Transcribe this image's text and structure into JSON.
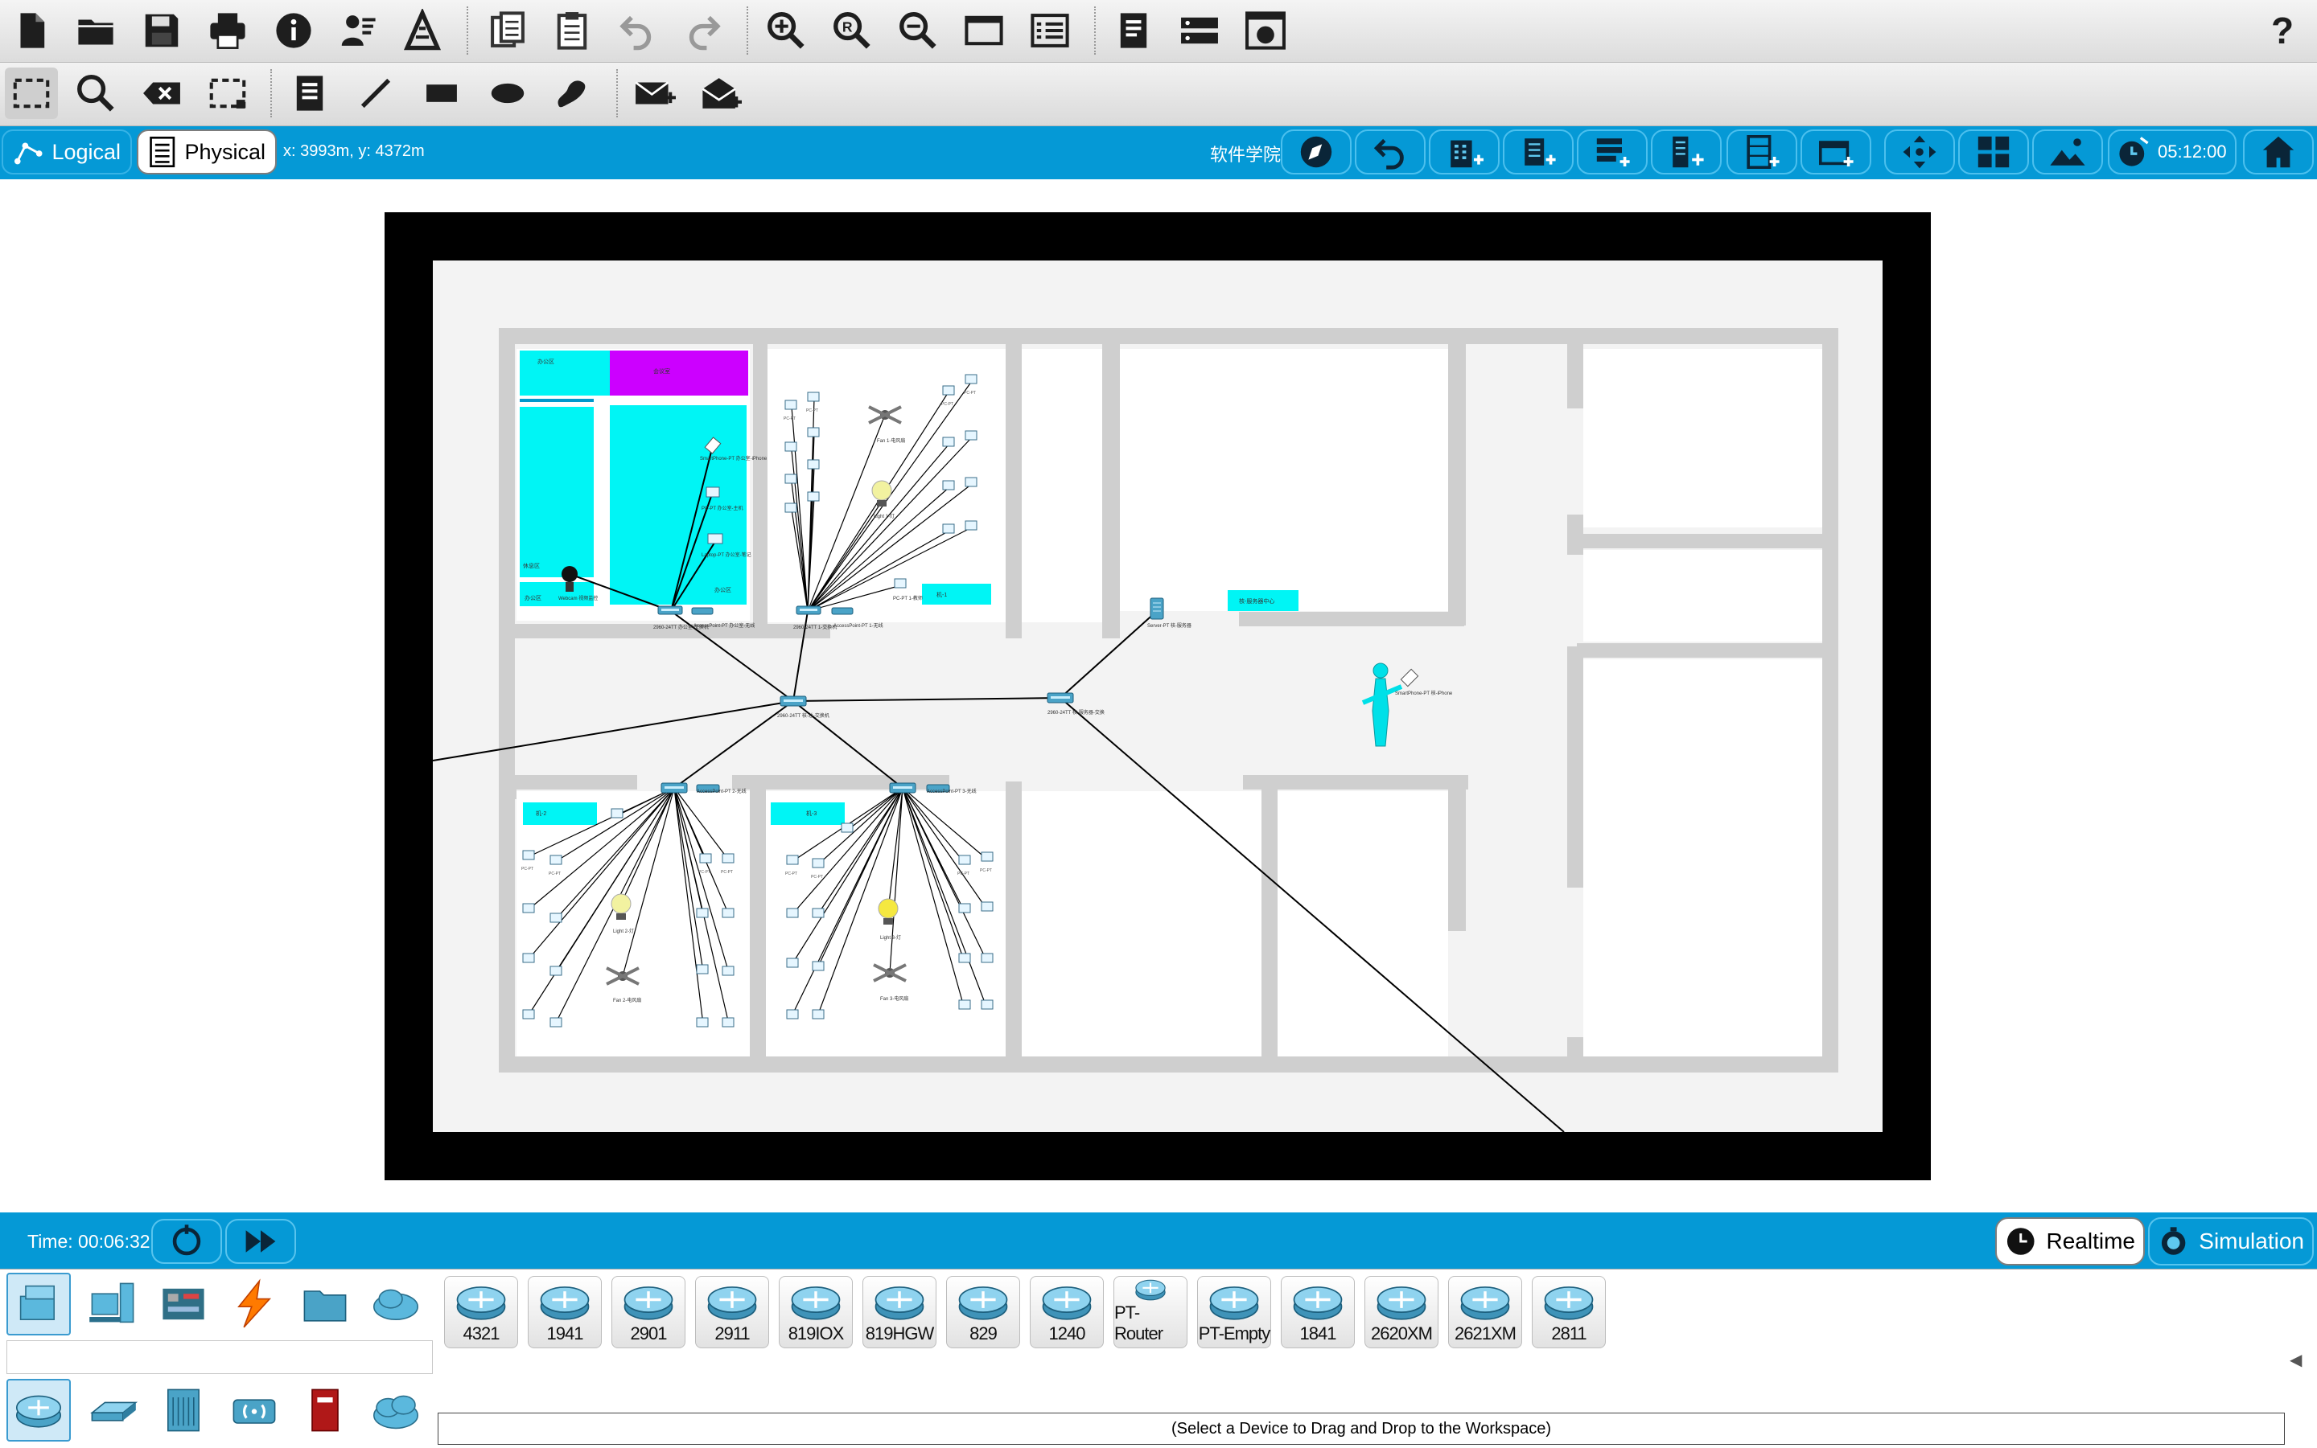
{
  "toolbar_main": {
    "icons": [
      "new-file-icon",
      "open-folder-icon",
      "save-icon",
      "print-icon",
      "info-icon",
      "user-profile-icon",
      "activity-wizard-icon",
      "copy-icon",
      "paste-icon",
      "undo-icon",
      "redo-icon",
      "zoom-in-icon",
      "zoom-reset-icon",
      "zoom-out-icon",
      "drawing-palette-icon",
      "custom-devices-icon",
      "notes-icon",
      "view-command-log-icon",
      "network-screenshot-icon",
      "help-icon"
    ],
    "help_label": "?"
  },
  "toolbar_secondary": {
    "icons": [
      "select-icon",
      "inspect-icon",
      "delete-icon",
      "resize-shape-icon",
      "place-note-icon",
      "draw-line-icon",
      "draw-rectangle-icon",
      "draw-ellipse-icon",
      "freeform-icon",
      "add-simple-pdu-icon",
      "add-complex-pdu-icon"
    ]
  },
  "navbar": {
    "logical_label": "Logical",
    "physical_label": "Physical",
    "coordinates": "x: 3993m, y: 4372m",
    "location_name": "软件学院",
    "clock": "05:12:00",
    "buttons": [
      "navigation-icon",
      "back-icon",
      "new-building-icon",
      "new-floor-icon",
      "new-rack-icon",
      "new-cabinet-icon",
      "new-closet-icon",
      "new-room-icon",
      "move-object-icon",
      "grid-icon",
      "background-image-icon",
      "clock-icon",
      "home-icon"
    ]
  },
  "canvas": {
    "building_background": "#000000",
    "floor_color": "#f2f2f2",
    "wall_color": "#cfcfcf",
    "cyan": "#00f5f5",
    "magenta": "#cc00ff",
    "link_color": "#000000",
    "labels": {
      "room1_top": "办公区",
      "room1_purple": "会议室",
      "room1_bl": "休息区",
      "room1_bl2": "办公区",
      "room1_right": "办公区",
      "room1_webcam": "Webcam\n视频监控",
      "room1_phone": "SmartPhone-PT\n办公室-iPhone",
      "room1_pc": "PC-PT\n办公室-主机",
      "room1_laptop": "Laptop-PT\n办公室-笔记",
      "room1_switch": "2960-24TT\n办公室-交换机",
      "room1_ap": "AccessPoint-PT\n办公室-无线",
      "room2_sw": "2960-24TT\n1-交换机",
      "room2_ap": "AccessPoint-PT\n1-无线",
      "room2_label": "机-1",
      "room2_fan": "Fan\n1-电风扇",
      "room2_light": "Light\n1-灯",
      "room2_pc_bottom": "PC-PT\n1-教师",
      "core_switch": "2960-24TT\n核-总-交换机",
      "dist_switch": "2960-24TT\n核-服务器-交换",
      "server": "Server-PT\n核-服务器",
      "server_room_label": "核-服务器中心",
      "person_phone": "SmartPhone-PT\n核-iPhone",
      "room3_label": "机-2",
      "room3_sw": "2960-24TT\n2-交换机",
      "room3_ap": "AccessPoint-PT\n2-无线",
      "room3_light": "Light\n2-灯",
      "room3_fan": "Fan\n2-电风扇",
      "room4_label": "机-3",
      "room4_sw": "2960-24TT\n3-交换机",
      "room4_ap": "AccessPoint-PT\n3-无线",
      "room4_light": "Light\n3-灯",
      "room4_fan": "Fan\n3-电风扇",
      "pc_generic": "PC-PT"
    }
  },
  "timebar": {
    "time_label": "Time: 00:06:32",
    "realtime_label": "Realtime",
    "simulation_label": "Simulation"
  },
  "device_panel": {
    "categories_top": [
      "network-devices-icon",
      "end-devices-icon",
      "components-icon",
      "connections-icon",
      "miscellaneous-icon",
      "multiuser-connection-icon"
    ],
    "categories_bottom": [
      "routers-icon",
      "switches-icon",
      "hubs-icon",
      "wireless-devices-icon",
      "security-icon",
      "wan-emulation-icon"
    ],
    "devices": [
      "4321",
      "1941",
      "2901",
      "2911",
      "819IOX",
      "819HGW",
      "829",
      "1240",
      "PT-Router",
      "PT-Empty",
      "1841",
      "2620XM",
      "2621XM",
      "2811"
    ],
    "search_value": "",
    "hint": "(Select a Device to Drag and Drop to the Workspace)"
  }
}
